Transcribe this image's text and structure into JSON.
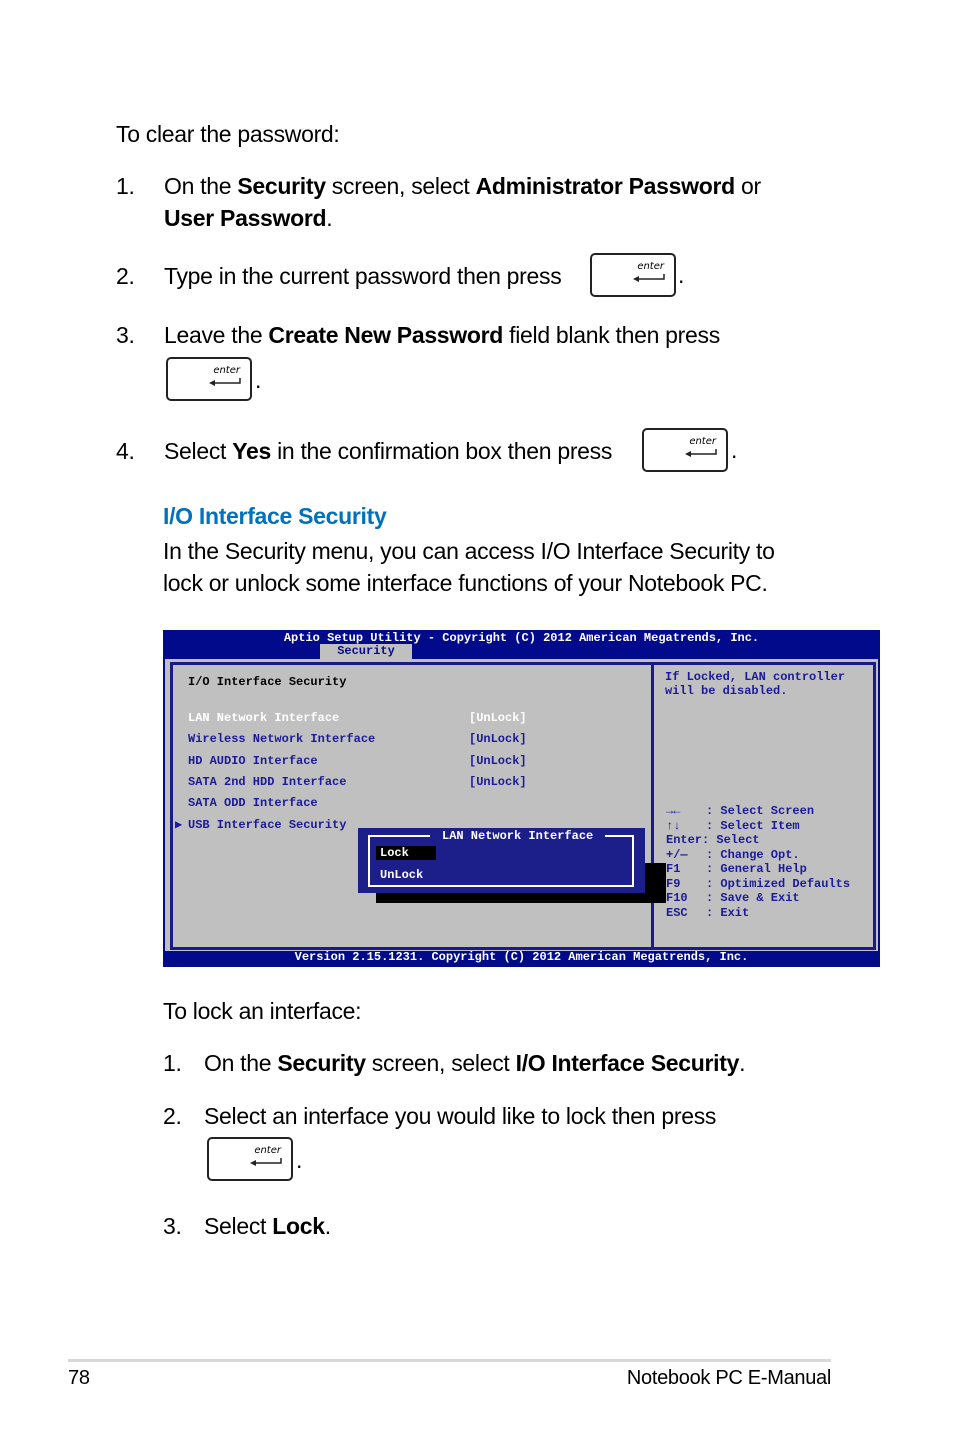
{
  "clear_password": {
    "intro": "To clear the password:",
    "steps": [
      {
        "num": "1.",
        "pre": "On the ",
        "b1": "Security",
        "mid": " screen, select ",
        "b2": "Administrator Password",
        "post": " or",
        "line2_b": "User Password",
        "line2_post": "."
      },
      {
        "num": "2.",
        "text": "Type in the current password then press",
        "end": "."
      },
      {
        "num": "3.",
        "pre": "Leave the ",
        "b1": "Create New Password",
        "post": " field blank then press",
        "end": "."
      },
      {
        "num": "4.",
        "pre": "Select ",
        "b1": "Yes",
        "post": " in the confirmation box then press",
        "end": "."
      }
    ]
  },
  "enter_key": {
    "label": "enter",
    "icon": "enter-arrow-icon"
  },
  "io_section": {
    "heading": "I/O Interface Security",
    "para_line1": "In the Security menu, you can access I/O Interface Security to",
    "para_line2": "lock or unlock some interface functions of your Notebook PC."
  },
  "bios": {
    "title": "Aptio Setup Utility - Copyright (C) 2012 American Megatrends, Inc.",
    "active_tab": "Security",
    "section_title": "I/O Interface Security",
    "items": [
      {
        "label": "LAN Network Interface",
        "value": "[UnLock]",
        "selected": true
      },
      {
        "label": "Wireless Network Interface",
        "value": "[UnLock]"
      },
      {
        "label": "HD AUDIO Interface",
        "value": "[UnLock]"
      },
      {
        "label": "SATA 2nd HDD Interface",
        "value": "[UnLock]"
      },
      {
        "label": "SATA ODD Interface",
        "value": ""
      },
      {
        "label": "USB Interface Security",
        "value": "",
        "submenu": true
      }
    ],
    "help_line1": "If Locked, LAN controller",
    "help_line2": "will be disabled.",
    "keys": [
      {
        "key": "→←",
        "desc": ": Select Screen"
      },
      {
        "key": "↑↓",
        "desc": ": Select Item"
      },
      {
        "key": "Enter",
        "desc": ": Select"
      },
      {
        "key": "+/—",
        "desc": ": Change Opt."
      },
      {
        "key": "F1",
        "desc": ": General Help"
      },
      {
        "key": "F9",
        "desc": ": Optimized Defaults"
      },
      {
        "key": "F10",
        "desc": ": Save & Exit"
      },
      {
        "key": "ESC",
        "desc": ": Exit"
      }
    ],
    "popup": {
      "title": "LAN Network Interface",
      "options": [
        "Lock",
        "UnLock"
      ],
      "highlighted": "Lock"
    },
    "footer": "Version 2.15.1231. Copyright (C) 2012 American Megatrends, Inc.",
    "colors": {
      "frame": "#000a8a",
      "body": "#c0c0c0",
      "text": "#1a1a9a",
      "popup": "#1c1f8a"
    }
  },
  "lock_interface": {
    "intro": "To lock an interface:",
    "steps": [
      {
        "num": "1.",
        "pre": "On the ",
        "b1": "Security",
        "mid": " screen, select ",
        "b2": "I/O Interface Security",
        "post": "."
      },
      {
        "num": "2.",
        "text": "Select an interface you would like to lock then press",
        "end": "."
      },
      {
        "num": "3.",
        "pre": "Select ",
        "b1": "Lock",
        "post": "."
      }
    ]
  },
  "footer": {
    "page_number": "78",
    "manual_title": "Notebook PC E-Manual"
  }
}
